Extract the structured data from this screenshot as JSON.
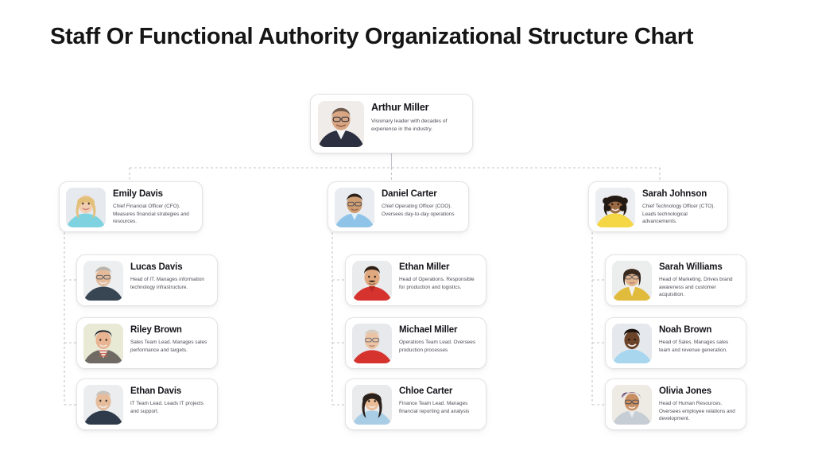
{
  "title": "Staff Or Functional Authority Organizational Structure Chart",
  "theme": {
    "background": "#ffffff",
    "card_background": "#ffffff",
    "card_border": "#e3e3e6",
    "connector_color": "#c4c4cc",
    "title_color": "#151515",
    "name_color": "#15151b",
    "desc_color": "#4d4d57"
  },
  "root": {
    "name": "Arthur Miller",
    "description": "Visionary leader with decades of experience in the industry.",
    "avatar": "avatar-arthur-miller",
    "avatar_bg": "#efece9",
    "avatar_shirt": "#2c2f3f",
    "avatar_skin": "#d8a683",
    "avatar_hair": "#6f5a4b"
  },
  "level2": [
    {
      "name": "Emily Davis",
      "description": "Chief Financial Officer (CFO). Measures financial strategies and resources.",
      "avatar": "avatar-emily-davis",
      "avatar_bg": "#e6e9ee",
      "avatar_shirt": "#7fd3e0",
      "avatar_skin": "#f2cdb0",
      "avatar_hair": "#e3c07a"
    },
    {
      "name": "Daniel Carter",
      "description": "Chief Operating Officer (COO). Oversees day-to-day operations",
      "avatar": "avatar-daniel-carter",
      "avatar_bg": "#e9ecf1",
      "avatar_shirt": "#8fc4e8",
      "avatar_skin": "#cf9e72",
      "avatar_hair": "#2b2119"
    },
    {
      "name": "Sarah Johnson",
      "description": "Chief Technology Officer (CTO). Leads technological advancements.",
      "avatar": "avatar-sarah-johnson",
      "avatar_bg": "#eceef1",
      "avatar_shirt": "#f5d645",
      "avatar_skin": "#9c6a45",
      "avatar_hair": "#241a14"
    }
  ],
  "level3": {
    "column_a": [
      {
        "name": "Lucas Davis",
        "description": "Head of IT. Manages information technology infrastructure.",
        "avatar": "avatar-lucas-davis",
        "avatar_bg": "#eceef0",
        "avatar_shirt": "#384552",
        "avatar_skin": "#e3bb9a",
        "avatar_hair": "#b9b4ae"
      },
      {
        "name": "Riley Brown",
        "description": "Sales Team Lead. Manages sales performance and targets.",
        "avatar": "avatar-riley-brown",
        "avatar_bg": "#e8ead6",
        "avatar_shirt": "#6f6a63",
        "avatar_skin": "#e8b491",
        "avatar_hair": "#1f2430"
      },
      {
        "name": "Ethan Davis",
        "description": "IT Team Lead. Leads IT projects and support.",
        "avatar": "avatar-ethan-davis",
        "avatar_bg": "#ebedef",
        "avatar_shirt": "#2f3b4a",
        "avatar_skin": "#e6bd9c",
        "avatar_hair": "#c8c3bd"
      }
    ],
    "column_b": [
      {
        "name": "Ethan Miller",
        "description": "Head of Operations. Responsible for production and logistics.",
        "avatar": "avatar-ethan-miller",
        "avatar_bg": "#e9ebed",
        "avatar_shirt": "#d6332e",
        "avatar_skin": "#dfa87e",
        "avatar_hair": "#2e1f16"
      },
      {
        "name": "Michael Miller",
        "description": "Operations Team Lead. Oversees production processes",
        "avatar": "avatar-michael-miller",
        "avatar_bg": "#e7e9ec",
        "avatar_shirt": "#d6332e",
        "avatar_skin": "#eac4a4",
        "avatar_hair": "#d8cfc4"
      },
      {
        "name": "Chloe Carter",
        "description": "Finance Team Lead. Manages financial reporting and analysis",
        "avatar": "avatar-chloe-carter",
        "avatar_bg": "#e9eaec",
        "avatar_shirt": "#aacde6",
        "avatar_skin": "#e8bd97",
        "avatar_hair": "#29201b"
      }
    ],
    "column_c": [
      {
        "name": "Sarah Williams",
        "description": "Head of Marketing. Drives brand awareness and customer acquisition.",
        "avatar": "avatar-sarah-williams",
        "avatar_bg": "#eceeee",
        "avatar_shirt": "#e0bb3c",
        "avatar_skin": "#e2b48d",
        "avatar_hair": "#38271c"
      },
      {
        "name": "Noah Brown",
        "description": "Head of Sales. Manages sales team and revenue generation.",
        "avatar": "avatar-noah-brown",
        "avatar_bg": "#e5e9ed",
        "avatar_shirt": "#a8d6ef",
        "avatar_skin": "#6b4329",
        "avatar_hair": "#1a120d"
      },
      {
        "name": "Olivia Jones",
        "description": "Head of Human Resources. Oversees employee relations and development.",
        "avatar": "avatar-olivia-jones",
        "avatar_bg": "#eeeae4",
        "avatar_shirt": "#c7cdd4",
        "avatar_skin": "#c98e62",
        "avatar_hair": "#5c3a6b"
      }
    ]
  }
}
